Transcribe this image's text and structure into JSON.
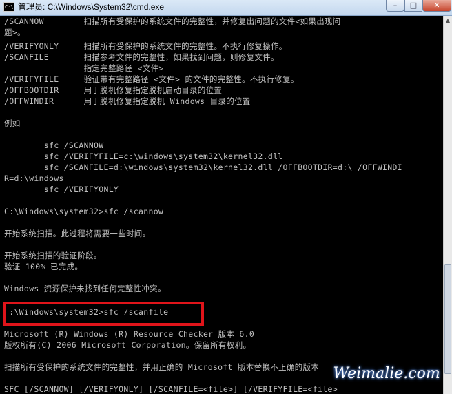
{
  "window": {
    "title": "管理员: C:\\Windows\\System32\\cmd.exe",
    "icon_text": "C:\\",
    "buttons": {
      "minimize": "–",
      "maximize": "□",
      "close": "✕"
    }
  },
  "console": {
    "lines": [
      "/SCANNOW        扫描所有受保护的系统文件的完整性，并修复出问题的文件<如果出现问",
      "题>。",
      "/VERIFYONLY     扫描所有受保护的系统文件的完整性。不执行修复操作。",
      "/SCANFILE       扫描参考文件的完整性，如果找到问题，则修复文件。",
      "                指定完整路径 <文件>",
      "/VERIFYFILE     验证带有完整路径 <文件> 的文件的完整性。不执行修复。",
      "/OFFBOOTDIR     用于脱机修复指定脱机启动目录的位置",
      "/OFFWINDIR      用于脱机修复指定脱机 Windows 目录的位置",
      "",
      "例如",
      "",
      "        sfc /SCANNOW",
      "        sfc /VERIFYFILE=c:\\windows\\system32\\kernel32.dll",
      "        sfc /SCANFILE=d:\\windows\\system32\\kernel32.dll /OFFBOOTDIR=d:\\ /OFFWINDI",
      "R=d:\\windows",
      "        sfc /VERIFYONLY",
      "",
      "C:\\Windows\\system32>sfc /scannow",
      "",
      "开始系统扫描。此过程将需要一些时间。",
      "",
      "开始系统扫描的验证阶段。",
      "验证 100% 已完成。",
      "",
      "Windows 资源保护未找到任何完整性冲突。",
      "",
      " :\\Windows\\system32>sfc /scanfile",
      "",
      "Microsoft (R) Windows (R) Resource Checker 版本 6.0",
      "版权所有(C) 2006 Microsoft Corporation。保留所有权利。",
      "",
      "扫描所有受保护的系统文件的完整性，并用正确的 Microsoft 版本替换不正确的版本",
      "",
      "SFC [/SCANNOW] [/VERIFYONLY] [/SCANFILE=<file>] [/VERIFYFILE=<file>"
    ]
  },
  "watermark": "Weimalie.com",
  "colors": {
    "console_bg": "#000000",
    "console_text": "#c0c0c0",
    "highlight": "#e0141a"
  }
}
